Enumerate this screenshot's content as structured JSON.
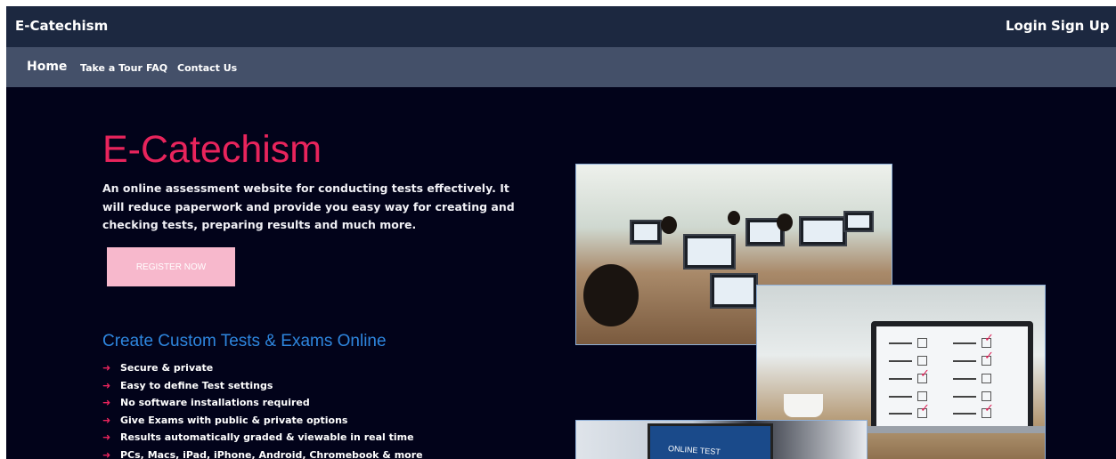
{
  "header": {
    "brand": "E-Catechism",
    "login_label": "Login",
    "signup_label": "Sign Up"
  },
  "nav": {
    "home": "Home",
    "items": [
      "Take a Tour",
      "FAQ",
      "Contact Us"
    ]
  },
  "hero": {
    "title": "E-Catechism",
    "description": "An online assessment website for conducting tests effectively. It will reduce paperwork and provide you easy way for creating and checking tests, preparing results and much more.",
    "register_label": "REGISTER NOW"
  },
  "features": {
    "title": "Create Custom Tests & Exams Online",
    "items": [
      "Secure & private",
      "Easy to define Test settings",
      "No software installations required",
      "Give Exams with public & private options",
      "Results automatically graded & viewable in real time",
      "PCs, Macs, iPad, iPhone, Android, Chromebook & more"
    ]
  },
  "images": {
    "online_test_text": "ONLINE TEST"
  },
  "colors": {
    "background": "#02031a",
    "topbar": "#1c2840",
    "navbar": "#445069",
    "accent_pink": "#e8245c",
    "subtitle_blue": "#2e86de",
    "button_pink": "#f7b8cc"
  }
}
